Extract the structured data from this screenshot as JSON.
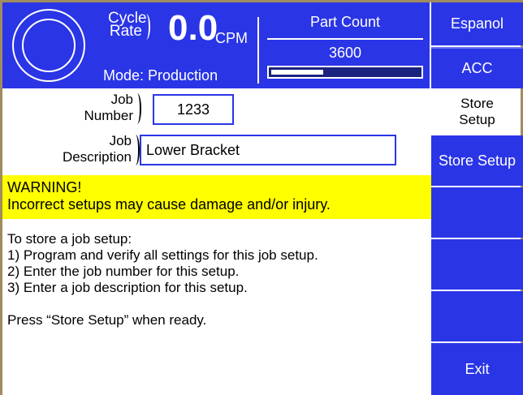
{
  "header": {
    "cycle_rate_line1": "Cycle",
    "cycle_rate_line2": "Rate",
    "rate_value": "0.0",
    "rate_unit": "CPM",
    "mode": "Mode: Production",
    "part_count_label": "Part Count",
    "part_count_value": "3600",
    "part_count_progress": 0.35
  },
  "side": {
    "espanol": "Espanol",
    "acc": "ACC",
    "store_setup_label_line1": "Store",
    "store_setup_label_line2": "Setup",
    "store_setup_button": "Store Setup",
    "exit": "Exit"
  },
  "form": {
    "job_number_label_line1": "Job",
    "job_number_label_line2": "Number",
    "job_number_value": "1233",
    "job_desc_label_line1": "Job",
    "job_desc_label_line2": "Description",
    "job_desc_value": "Lower Bracket"
  },
  "warning": {
    "title": "WARNING!",
    "text": "Incorrect setups may cause damage and/or injury."
  },
  "instructions": {
    "lines": [
      "To store a job setup:",
      "1) Program and verify all settings for this job setup.",
      "2) Enter the job number for this setup.",
      "3) Enter a job description for this setup.",
      "",
      "Press “Store Setup” when ready."
    ]
  },
  "colors": {
    "primary_blue": "#2a35e6",
    "warning_yellow": "#ffff00",
    "frame": "#a08c5c"
  }
}
